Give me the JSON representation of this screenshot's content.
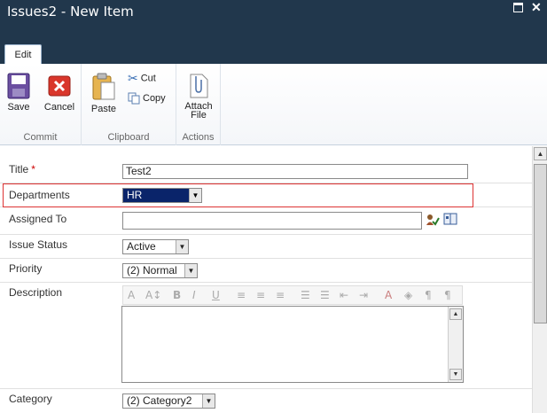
{
  "window": {
    "title": "Issues2 - New Item"
  },
  "tabs": {
    "edit": "Edit"
  },
  "ribbon": {
    "commit": {
      "label": "Commit",
      "save": "Save",
      "cancel": "Cancel"
    },
    "clipboard": {
      "label": "Clipboard",
      "paste": "Paste",
      "cut": "Cut",
      "copy": "Copy"
    },
    "actions": {
      "label": "Actions",
      "attach_line1": "Attach",
      "attach_line2": "File"
    }
  },
  "form": {
    "title": {
      "label": "Title",
      "required": "*",
      "value": "Test2"
    },
    "departments": {
      "label": "Departments",
      "value": "HR"
    },
    "assigned_to": {
      "label": "Assigned To",
      "value": ""
    },
    "issue_status": {
      "label": "Issue Status",
      "value": "Active"
    },
    "priority": {
      "label": "Priority",
      "value": "(2) Normal"
    },
    "description": {
      "label": "Description",
      "value": ""
    },
    "category": {
      "label": "Category",
      "value": "(2) Category2"
    }
  },
  "colors": {
    "titlebar": "#21374c",
    "highlight": "#dd3333",
    "selection": "#0a246a"
  }
}
